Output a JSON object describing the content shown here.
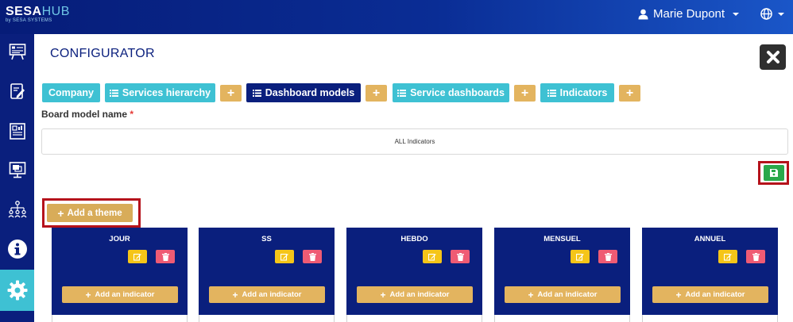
{
  "header": {
    "logo_main": "SESA",
    "logo_hub": "HUB",
    "logo_sub": "by SESA SYSTEMS",
    "user_name": "Marie Dupont"
  },
  "sidebar": {
    "items": [
      {
        "icon": "presentation-board-icon"
      },
      {
        "icon": "clipboard-edit-icon"
      },
      {
        "icon": "report-chart-icon"
      },
      {
        "icon": "monitor-icon"
      },
      {
        "icon": "org-hierarchy-icon"
      },
      {
        "icon": "info-icon"
      },
      {
        "icon": "gear-icon",
        "active": true
      }
    ]
  },
  "page": {
    "title": "CONFIGURATOR"
  },
  "tabs": [
    {
      "label": "Company",
      "style": "cyan"
    },
    {
      "label": "Services hierarchy",
      "style": "cyan"
    },
    {
      "label": "Dashboard models",
      "style": "navy"
    },
    {
      "label": "Service dashboards",
      "style": "cyan"
    },
    {
      "label": "Indicators",
      "style": "cyan"
    }
  ],
  "form": {
    "board_model_label": "Board model name",
    "required_mark": "*",
    "board_model_value": "ALL Indicators"
  },
  "actions": {
    "add_theme_label": "Add a theme",
    "add_indicator_label": "Add an indicator"
  },
  "themes": [
    {
      "name": "JOUR"
    },
    {
      "name": "SS"
    },
    {
      "name": "HEBDO"
    },
    {
      "name": "MENSUEL"
    },
    {
      "name": "ANNUEL"
    }
  ],
  "colors": {
    "navy": "#0a1f7d",
    "cyan": "#3ec1d3",
    "gold": "#e3b45f",
    "save_green": "#2aa84a",
    "delete_pink": "#ef5b74",
    "edit_yellow": "#f5c518",
    "highlight_red": "#b5121b"
  }
}
